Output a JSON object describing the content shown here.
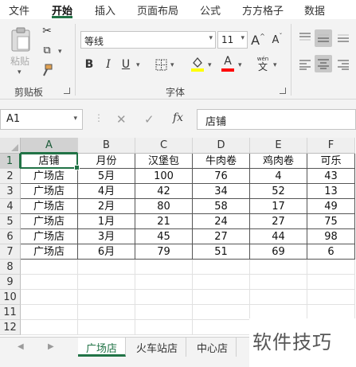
{
  "ribbon_tabs": [
    "文件",
    "开始",
    "插入",
    "页面布局",
    "公式",
    "方方格子",
    "数据"
  ],
  "active_tab": "开始",
  "ribbon": {
    "paste_label": "粘贴",
    "clipboard_group": "剪贴板",
    "font_name": "等线",
    "font_size": "11",
    "bold": "B",
    "italic": "I",
    "underline": "U",
    "grow_font": "A",
    "shrink_font": "A",
    "font_color_letter": "A",
    "wen_label": "wén",
    "wen_char": "文",
    "font_group": "字体",
    "colors": {
      "accent": "#217346",
      "highlight": "#ffff00",
      "font_color": "#ff0000"
    }
  },
  "formula_bar": {
    "name_box": "A1",
    "fx_label": "fx",
    "content": "店铺"
  },
  "sheet": {
    "columns": [
      "A",
      "B",
      "C",
      "D",
      "E",
      "F"
    ],
    "rows": [
      "1",
      "2",
      "3",
      "4",
      "5",
      "6",
      "7",
      "8",
      "9",
      "10",
      "11",
      "12"
    ],
    "selected_cell": "A1",
    "table": [
      [
        "店铺",
        "月份",
        "汉堡包",
        "牛肉卷",
        "鸡肉卷",
        "可乐"
      ],
      [
        "广场店",
        "5月",
        "100",
        "76",
        "4",
        "43"
      ],
      [
        "广场店",
        "4月",
        "42",
        "34",
        "52",
        "13"
      ],
      [
        "广场店",
        "2月",
        "80",
        "58",
        "17",
        "49"
      ],
      [
        "广场店",
        "1月",
        "21",
        "24",
        "27",
        "75"
      ],
      [
        "广场店",
        "3月",
        "45",
        "27",
        "44",
        "98"
      ],
      [
        "广场店",
        "6月",
        "79",
        "51",
        "69",
        "6"
      ]
    ]
  },
  "sheet_tabs": [
    "广场店",
    "火车站店",
    "中心店"
  ],
  "active_sheet": "广场店",
  "watermark": "软件技巧"
}
